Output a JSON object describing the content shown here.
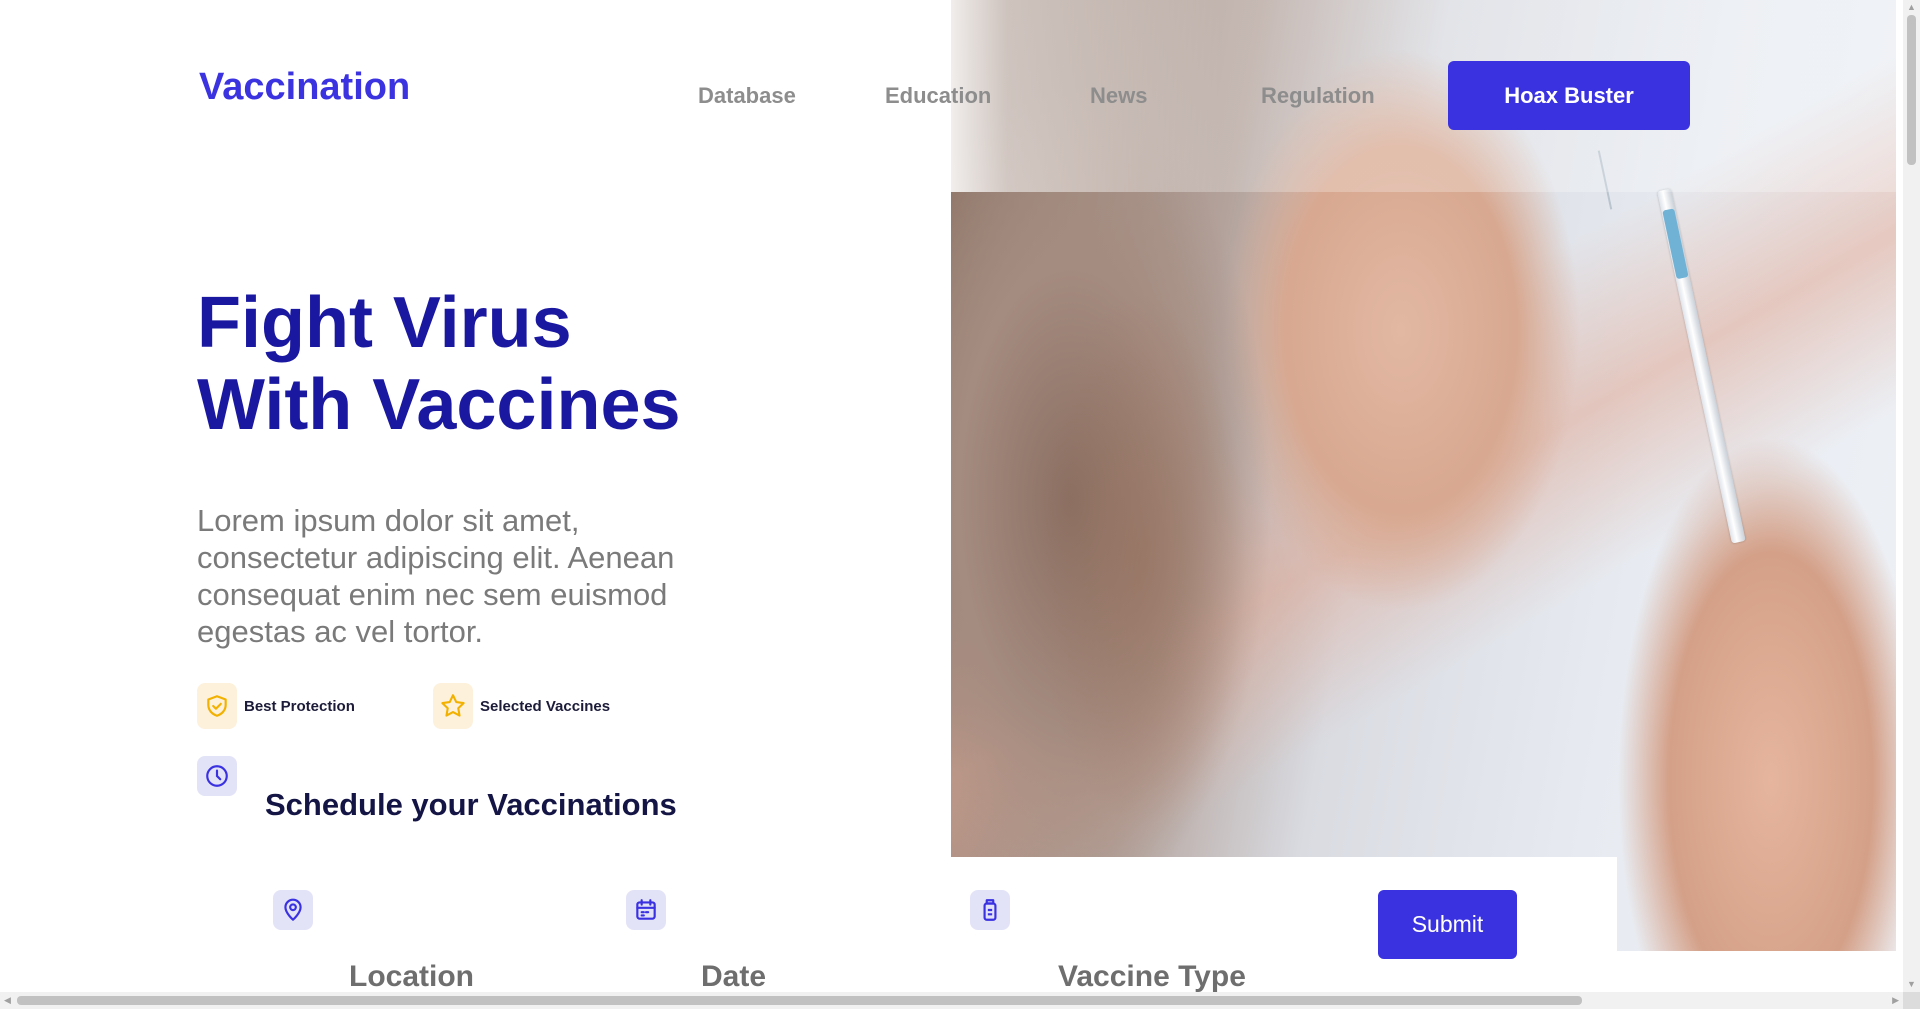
{
  "header": {
    "logo": "Vaccination",
    "nav": [
      "Database",
      "Education",
      "News",
      "Regulation"
    ],
    "cta_label": "Hoax Buster"
  },
  "hero": {
    "title_line1": "Fight Virus",
    "title_line2": "With Vaccines",
    "description": "Lorem ipsum dolor sit amet, consectetur adipiscing elit. Aenean consequat enim nec sem euismod egestas ac vel tortor.",
    "features": [
      {
        "icon": "shield-check-icon",
        "label": "Best Protection"
      },
      {
        "icon": "star-icon",
        "label": "Selected Vaccines"
      }
    ]
  },
  "schedule": {
    "icon": "clock-icon",
    "title": "Schedule your Vaccinations",
    "fields": [
      {
        "icon": "location-pin-icon",
        "label": "Location"
      },
      {
        "icon": "calendar-icon",
        "label": "Date"
      },
      {
        "icon": "vaccine-bottle-icon",
        "label": "Vaccine Type"
      }
    ],
    "submit_label": "Submit"
  },
  "colors": {
    "brand": "#3a31e1",
    "title": "#1a18a0",
    "feature_icon_bg": "#fdf1dc",
    "feature_icon": "#f2b100",
    "schedule_icon_bg": "#e3e3f8"
  }
}
